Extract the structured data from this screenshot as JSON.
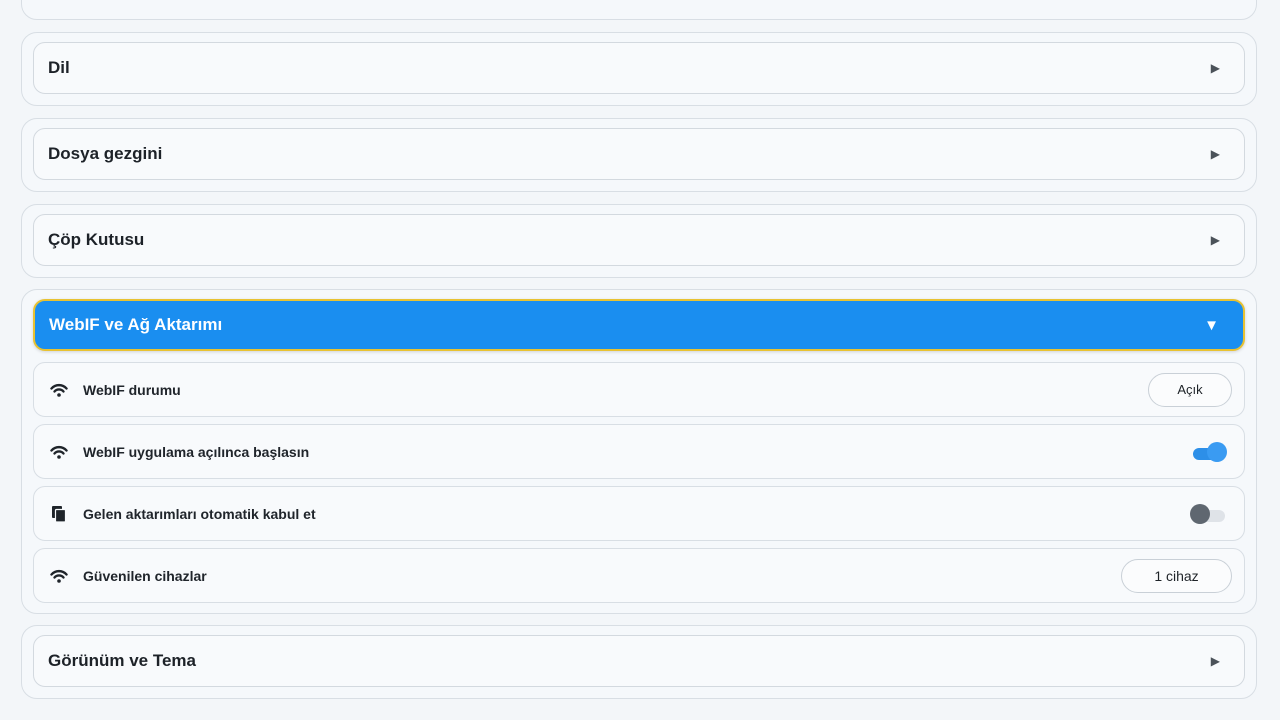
{
  "sections": [
    {
      "title": "Dil",
      "arrow": "▶"
    },
    {
      "title": "Dosya gezgini",
      "arrow": "▶"
    },
    {
      "title": "Çöp Kutusu",
      "arrow": "▶"
    },
    {
      "title": "WebIF ve Ağ Aktarımı",
      "arrow": "▼",
      "expanded": true
    },
    {
      "title": "Görünüm ve Tema",
      "arrow": "▶"
    }
  ],
  "webif": {
    "rows": [
      {
        "label": "WebIF durumu",
        "icon": "wifi-icon",
        "control": "button",
        "value": "Açık"
      },
      {
        "label": "WebIF uygulama açılınca başlasın",
        "icon": "wifi-icon",
        "control": "toggle",
        "checked": true
      },
      {
        "label": "Gelen aktarımları otomatik kabul et",
        "icon": "copy-icon",
        "control": "toggle",
        "checked": false
      },
      {
        "label": "Güvenilen cihazlar",
        "icon": "wifi-icon",
        "control": "button",
        "value": "1 cihaz"
      }
    ]
  },
  "colors": {
    "accent": "#1a8ef0",
    "focus_outline": "#e8c232",
    "toggle_on": "#3a9bf2",
    "toggle_off": "#5f6770"
  }
}
